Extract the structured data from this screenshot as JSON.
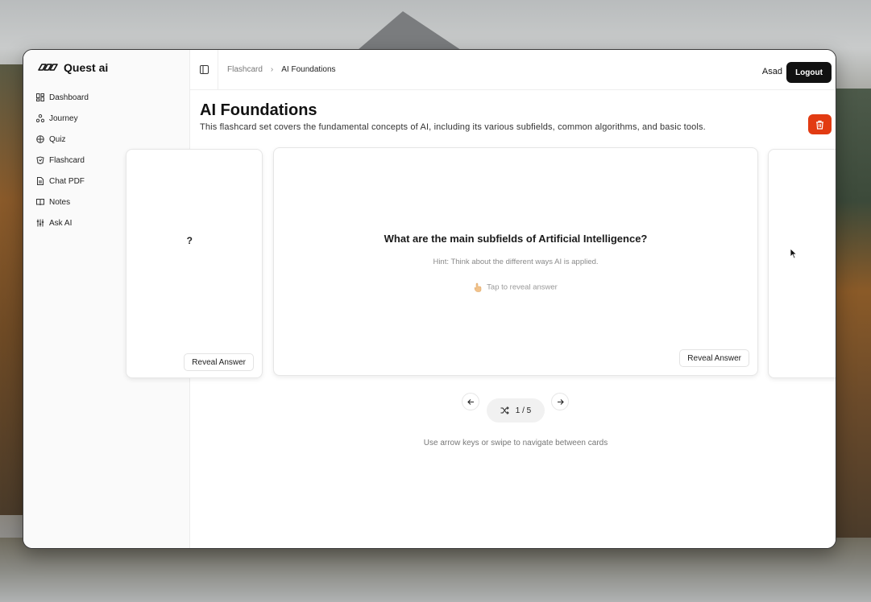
{
  "app": {
    "name": "Quest ai"
  },
  "sidebar": {
    "items": [
      {
        "label": "Dashboard",
        "icon": "dashboard-icon"
      },
      {
        "label": "Journey",
        "icon": "journey-icon"
      },
      {
        "label": "Quiz",
        "icon": "quiz-icon"
      },
      {
        "label": "Flashcard",
        "icon": "flashcard-icon"
      },
      {
        "label": "Chat PDF",
        "icon": "document-icon"
      },
      {
        "label": "Notes",
        "icon": "book-icon"
      },
      {
        "label": "Ask AI",
        "icon": "sliders-icon"
      }
    ]
  },
  "header": {
    "breadcrumb": {
      "parent": "Flashcard",
      "separator": "›",
      "current": "AI Foundations"
    },
    "user_name": "Asad",
    "logout_label": "Logout"
  },
  "page": {
    "title": "AI Foundations",
    "description": "This flashcard set covers the fundamental concepts of AI, including its various subfields, common algorithms, and basic tools."
  },
  "cards": {
    "previous": {
      "question_fragment": "?",
      "reveal_label": "Reveal Answer"
    },
    "current": {
      "question": "What are the main subfields of Artificial Intelligence?",
      "hint": "Hint: Think about the different ways AI is applied.",
      "tap_text": "Tap to reveal answer",
      "reveal_label": "Reveal Answer"
    }
  },
  "pagination": {
    "counter": "1 / 5",
    "current": 1,
    "total": 5
  },
  "help_text": "Use arrow keys or swipe to navigate between cards",
  "colors": {
    "delete_button": "#e23b12",
    "logout_button": "#111111"
  }
}
